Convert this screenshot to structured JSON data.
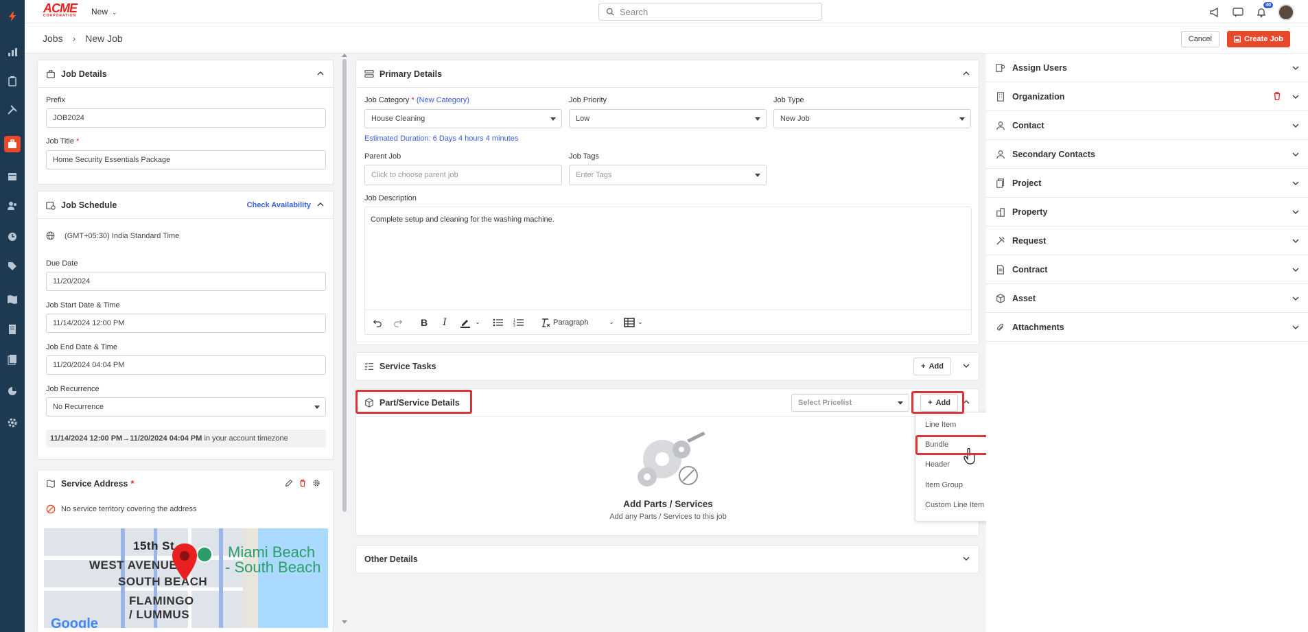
{
  "app": {
    "brand_top": "ACME",
    "brand_bottom": "CORPORATION",
    "new_label": "New",
    "search_placeholder": "Search",
    "notification_count": "40",
    "colors": {
      "accent": "#e8492a",
      "nav_bg": "#1e3a52",
      "link": "#3a5dd8",
      "highlight": "#d9343a"
    }
  },
  "nav_icons": [
    "lightning-logo-icon",
    "chart-icon",
    "clipboard-icon",
    "tools-icon",
    "briefcase-icon",
    "calendar-icon",
    "users-icon",
    "clock-icon",
    "tag-icon",
    "map-icon",
    "invoice-icon",
    "documents-icon",
    "pie-chart-icon",
    "settings-icon"
  ],
  "breadcrumb": {
    "parent": "Jobs",
    "current": "New Job"
  },
  "actions": {
    "cancel": "Cancel",
    "create": "Create Job"
  },
  "job_details": {
    "title": "Job Details",
    "prefix_label": "Prefix",
    "prefix_value": "JOB2024",
    "job_title_label": "Job Title",
    "job_title_value": "Home Security Essentials Package"
  },
  "job_schedule": {
    "title": "Job Schedule",
    "check_availability": "Check Availability",
    "timezone": "(GMT+05:30) India Standard Time",
    "due_date_label": "Due Date",
    "due_date": "11/20/2024",
    "start_label": "Job Start Date & Time",
    "start_value": "11/14/2024 12:00 PM",
    "end_label": "Job End Date & Time",
    "end_value": "11/20/2024 04:04 PM",
    "recurrence_label": "Job Recurrence",
    "recurrence_value": "No Recurrence",
    "summary_range": "11/14/2024 12:00 PM→11/20/2024 04:04 PM",
    "summary_suffix": " in your account timezone"
  },
  "service_address": {
    "title": "Service Address",
    "no_territory": "No service territory covering the address",
    "map_labels": {
      "street": "15th St",
      "west_avenue": "WEST AVENUE",
      "south_beach": "SOUTH BEACH",
      "flamingo": "FLAMINGO",
      "lummus": "/ LUMMUS",
      "miami1": "Miami Beach",
      "miami2": "- South Beach",
      "google": "Google"
    }
  },
  "primary_details": {
    "title": "Primary Details",
    "category_label": "Job Category",
    "new_category": "(New Category)",
    "category_value": "House Cleaning",
    "priority_label": "Job Priority",
    "priority_value": "Low",
    "type_label": "Job Type",
    "type_value": "New Job",
    "estimated": "Estimated Duration: 6 Days 4 hours 4 minutes",
    "parent_label": "Parent Job",
    "parent_placeholder": "Click to choose parent job",
    "tags_label": "Job Tags",
    "tags_placeholder": "Enter Tags",
    "desc_label": "Job Description",
    "desc_value": "Complete setup and cleaning for the washing machine.",
    "paragraph": "Paragraph"
  },
  "service_tasks": {
    "title": "Service Tasks",
    "add": "Add"
  },
  "parts": {
    "title": "Part/Service Details",
    "pricelist_placeholder": "Select Pricelist",
    "add": "Add",
    "empty_title": "Add Parts / Services",
    "empty_sub": "Add any Parts / Services to this job",
    "menu": [
      "Line Item",
      "Bundle",
      "Header",
      "Item Group",
      "Custom Line Item"
    ]
  },
  "other_details": {
    "title": "Other Details"
  },
  "right_panel": [
    "Assign Users",
    "Organization",
    "Contact",
    "Secondary Contacts",
    "Project",
    "Property",
    "Request",
    "Contract",
    "Asset",
    "Attachments"
  ]
}
